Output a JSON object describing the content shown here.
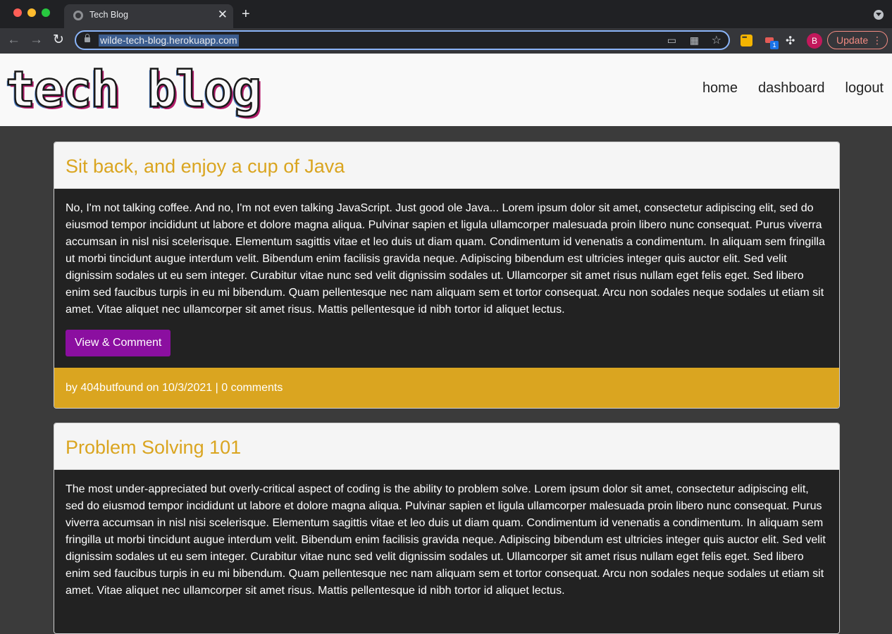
{
  "browser": {
    "tab_title": "Tech Blog",
    "tab_close": "✕",
    "new_tab": "+",
    "url": "wilde-tech-blog.herokuapp.com",
    "back": "←",
    "forward": "→",
    "reload": "↻",
    "star": "☆",
    "extension_badge": "1",
    "avatar_initial": "B",
    "update_label": "Update",
    "update_menu": "⋮"
  },
  "site": {
    "logo_text": "tech blog",
    "nav": [
      {
        "label": "home"
      },
      {
        "label": "dashboard"
      },
      {
        "label": "logout"
      }
    ]
  },
  "posts": [
    {
      "title": "Sit back, and enjoy a cup of Java",
      "body": "No, I'm not talking coffee. And no, I'm not even talking JavaScript. Just good ole Java... Lorem ipsum dolor sit amet, consectetur adipiscing elit, sed do eiusmod tempor incididunt ut labore et dolore magna aliqua. Pulvinar sapien et ligula ullamcorper malesuada proin libero nunc consequat. Purus viverra accumsan in nisl nisi scelerisque. Elementum sagittis vitae et leo duis ut diam quam. Condimentum id venenatis a condimentum. In aliquam sem fringilla ut morbi tincidunt augue interdum velit. Bibendum enim facilisis gravida neque. Adipiscing bibendum est ultricies integer quis auctor elit. Sed velit dignissim sodales ut eu sem integer. Curabitur vitae nunc sed velit dignissim sodales ut. Ullamcorper sit amet risus nullam eget felis eget. Sed libero enim sed faucibus turpis in eu mi bibendum. Quam pellentesque nec nam aliquam sem et tortor consequat. Arcu non sodales neque sodales ut etiam sit amet. Vitae aliquet nec ullamcorper sit amet risus. Mattis pellentesque id nibh tortor id aliquet lectus.",
      "button_label": "View & Comment",
      "footer": "by 404butfound on 10/3/2021 | 0 comments"
    },
    {
      "title": "Problem Solving 101",
      "body": "The most under-appreciated but overly-critical aspect of coding is the ability to problem solve. Lorem ipsum dolor sit amet, consectetur adipiscing elit, sed do eiusmod tempor incididunt ut labore et dolore magna aliqua. Pulvinar sapien et ligula ullamcorper malesuada proin libero nunc consequat. Purus viverra accumsan in nisl nisi scelerisque. Elementum sagittis vitae et leo duis ut diam quam. Condimentum id venenatis a condimentum. In aliquam sem fringilla ut morbi tincidunt augue interdum velit. Bibendum enim facilisis gravida neque. Adipiscing bibendum est ultricies integer quis auctor elit. Sed velit dignissim sodales ut eu sem integer. Curabitur vitae nunc sed velit dignissim sodales ut. Ullamcorper sit amet risus nullam eget felis eget. Sed libero enim sed faucibus turpis in eu mi bibendum. Quam pellentesque nec nam aliquam sem et tortor consequat. Arcu non sodales neque sodales ut etiam sit amet. Vitae aliquet nec ullamcorper sit amet risus. Mattis pellentesque id nibh tortor id aliquet lectus."
    }
  ],
  "colors": {
    "accent": "#daa520",
    "button": "#8b0fa0",
    "card_body": "#222222",
    "page_bg": "#3b3b3b"
  }
}
